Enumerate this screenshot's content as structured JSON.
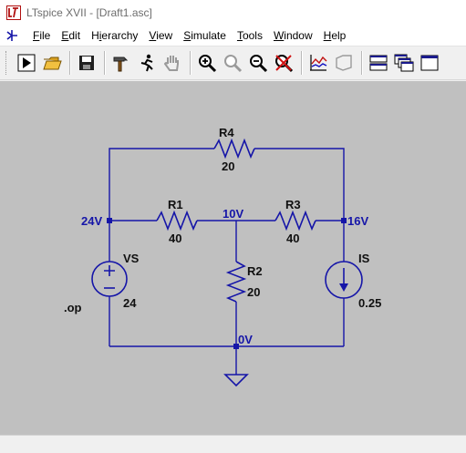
{
  "window": {
    "title": "LTspice XVII - [Draft1.asc]",
    "app_icon": "ltspice-logo-icon"
  },
  "menu": [
    {
      "label": "File",
      "hotkey": "F"
    },
    {
      "label": "Edit",
      "hotkey": "E"
    },
    {
      "label": "Hierarchy",
      "hotkey": "i"
    },
    {
      "label": "View",
      "hotkey": "V"
    },
    {
      "label": "Simulate",
      "hotkey": "S"
    },
    {
      "label": "Tools",
      "hotkey": "T"
    },
    {
      "label": "Window",
      "hotkey": "W"
    },
    {
      "label": "Help",
      "hotkey": "H"
    }
  ],
  "toolbar": [
    "run-icon",
    "open-folder-icon",
    "save-icon",
    "control-panel-hammer-icon",
    "halt-running-man-icon",
    "pan-hand-icon",
    "zoom-in-icon",
    "zoom-full-icon",
    "zoom-out-icon",
    "zoom-cancel-icon",
    "autorange-icon",
    "waveform-icon",
    "tile-horizontal-icon",
    "cascade-icon",
    "tile-vertical-icon"
  ],
  "schematic": {
    "background_color": "#c0c0c0",
    "wire_color": "#1515a8",
    "components": [
      {
        "ref": "R4",
        "value": "20"
      },
      {
        "ref": "R1",
        "value": "40"
      },
      {
        "ref": "R3",
        "value": "40"
      },
      {
        "ref": "R2",
        "value": "20"
      },
      {
        "ref": "VS",
        "value": "24"
      },
      {
        "ref": "IS",
        "value": "0.25"
      }
    ],
    "directive": ".op",
    "net_labels": {
      "left_node": "24V",
      "middle_node": "10V",
      "right_node": "16V",
      "ground_node": "0V"
    }
  }
}
